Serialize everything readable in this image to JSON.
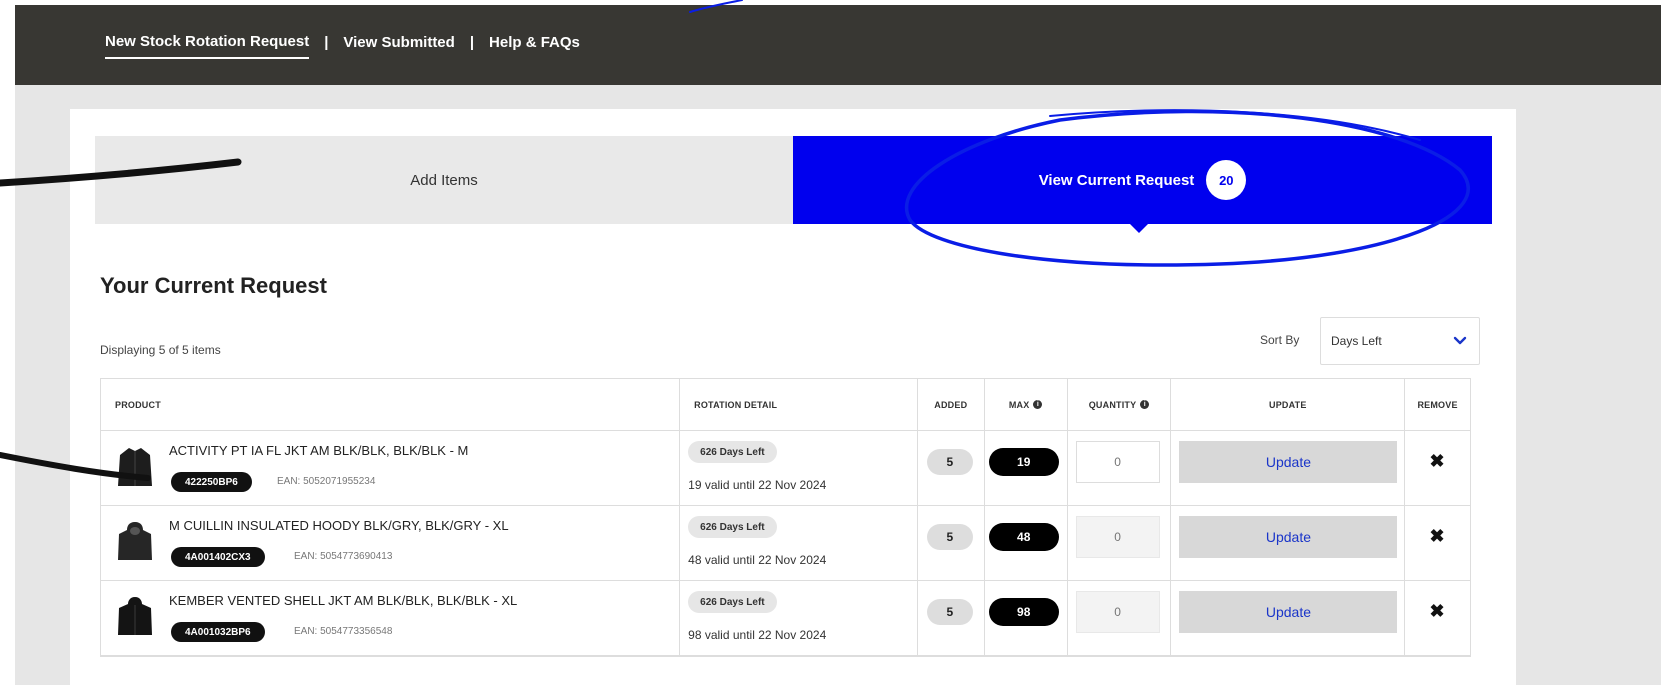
{
  "nav": {
    "items": [
      {
        "label": "New Stock Rotation Request"
      },
      {
        "label": "View Submitted"
      },
      {
        "label": "Help & FAQs"
      }
    ],
    "separator": "|"
  },
  "tabs": {
    "add_items": "Add Items",
    "view_current": "View Current Request",
    "count": "20"
  },
  "page": {
    "title": "Your Current Request",
    "display_count": "Displaying 5 of 5 items",
    "sort_label": "Sort By",
    "sort_value": "Days Left"
  },
  "table": {
    "headers": {
      "product": "PRODUCT",
      "rotation": "ROTATION DETAIL",
      "added": "ADDED",
      "max": "MAX",
      "quantity": "QUANTITY",
      "update": "UPDATE",
      "remove": "REMOVE"
    },
    "info_glyph": "i",
    "remove_glyph": "✖",
    "rows": [
      {
        "name": "ACTIVITY PT IA FL JKT AM BLK/BLK, BLK/BLK - M",
        "sku": "422250BP6",
        "ean": "EAN: 5052071955234",
        "days_left": "626 Days Left",
        "valid": "19 valid until 22 Nov 2024",
        "added": "5",
        "max": "19",
        "qty_placeholder": "0",
        "update": "Update"
      },
      {
        "name": "M CUILLIN INSULATED HOODY BLK/GRY, BLK/GRY - XL",
        "sku": "4A001402CX3",
        "ean": "EAN: 5054773690413",
        "days_left": "626 Days Left",
        "valid": "48 valid until 22 Nov 2024",
        "added": "5",
        "max": "48",
        "qty_placeholder": "0",
        "update": "Update"
      },
      {
        "name": "KEMBER VENTED SHELL JKT AM BLK/BLK, BLK/BLK - XL",
        "sku": "4A001032BP6",
        "ean": "EAN: 5054773356548",
        "days_left": "626 Days Left",
        "valid": "98 valid until 22 Nov 2024",
        "added": "5",
        "max": "98",
        "qty_placeholder": "0",
        "update": "Update"
      }
    ]
  },
  "colors": {
    "nav_bg": "#383733",
    "accent_blue": "#0000ee",
    "annotation_blue": "#0a1de6",
    "annotation_black": "#111111"
  }
}
